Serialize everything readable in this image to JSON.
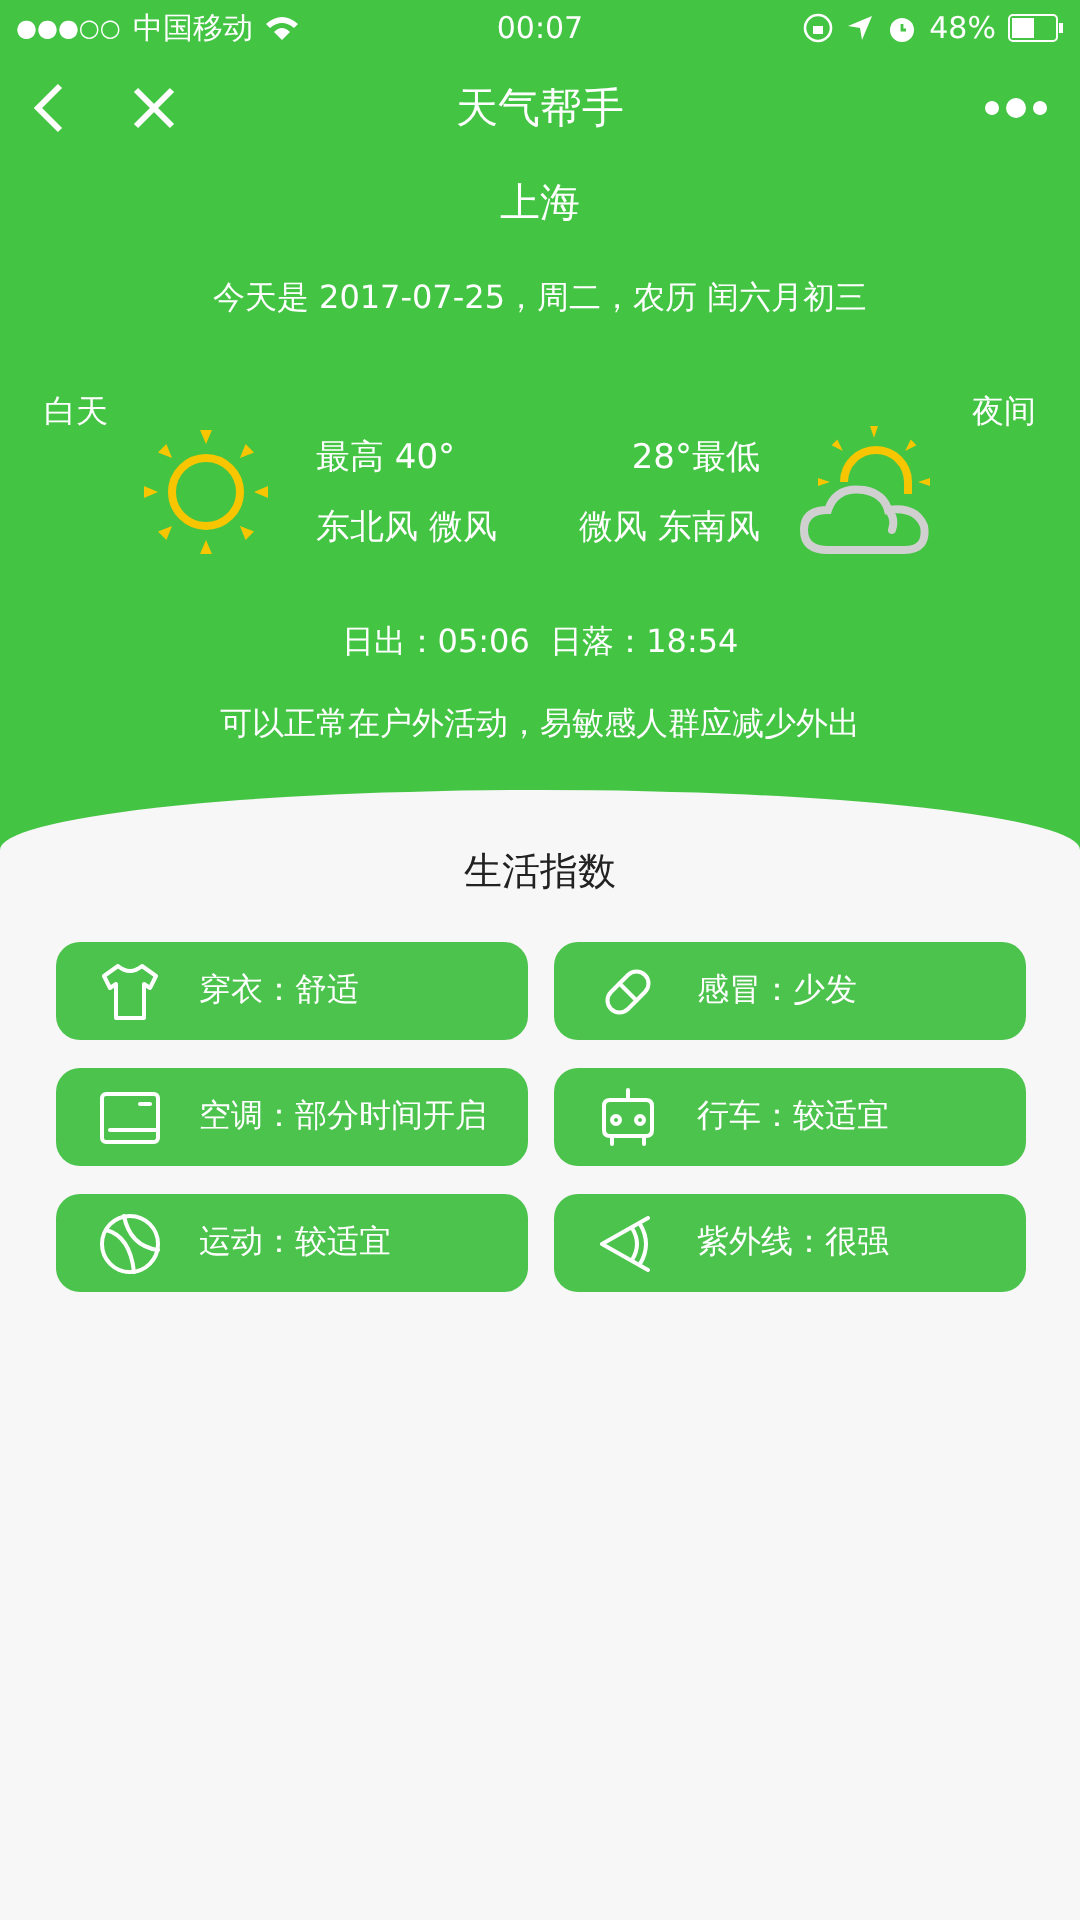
{
  "status_bar": {
    "signal_dots": "●●●○○",
    "carrier": "中国移动",
    "time": "00:07",
    "battery": "48%"
  },
  "nav": {
    "title": "天气帮手"
  },
  "city": "上海",
  "date": "今天是 2017-07-25，周二，农历 闰六月初三",
  "day": {
    "label": "白天",
    "temp": "最高 40°",
    "wind": "东北风 微风"
  },
  "night": {
    "label": "夜间",
    "temp": "28°最低",
    "wind": "微风 东南风"
  },
  "sun_times": "日出：05:06  日落：18:54",
  "advice": "可以正常在户外活动，易敏感人群应减少外出",
  "indices_title": "生活指数",
  "indices": [
    {
      "kind": "clothing",
      "text": "穿衣：舒适"
    },
    {
      "kind": "cold",
      "text": "感冒：少发"
    },
    {
      "kind": "aircon",
      "text": "空调：部分时间开启"
    },
    {
      "kind": "driving",
      "text": "行车：较适宜"
    },
    {
      "kind": "sport",
      "text": "运动：较适宜"
    },
    {
      "kind": "uv",
      "text": "紫外线：很强"
    }
  ]
}
